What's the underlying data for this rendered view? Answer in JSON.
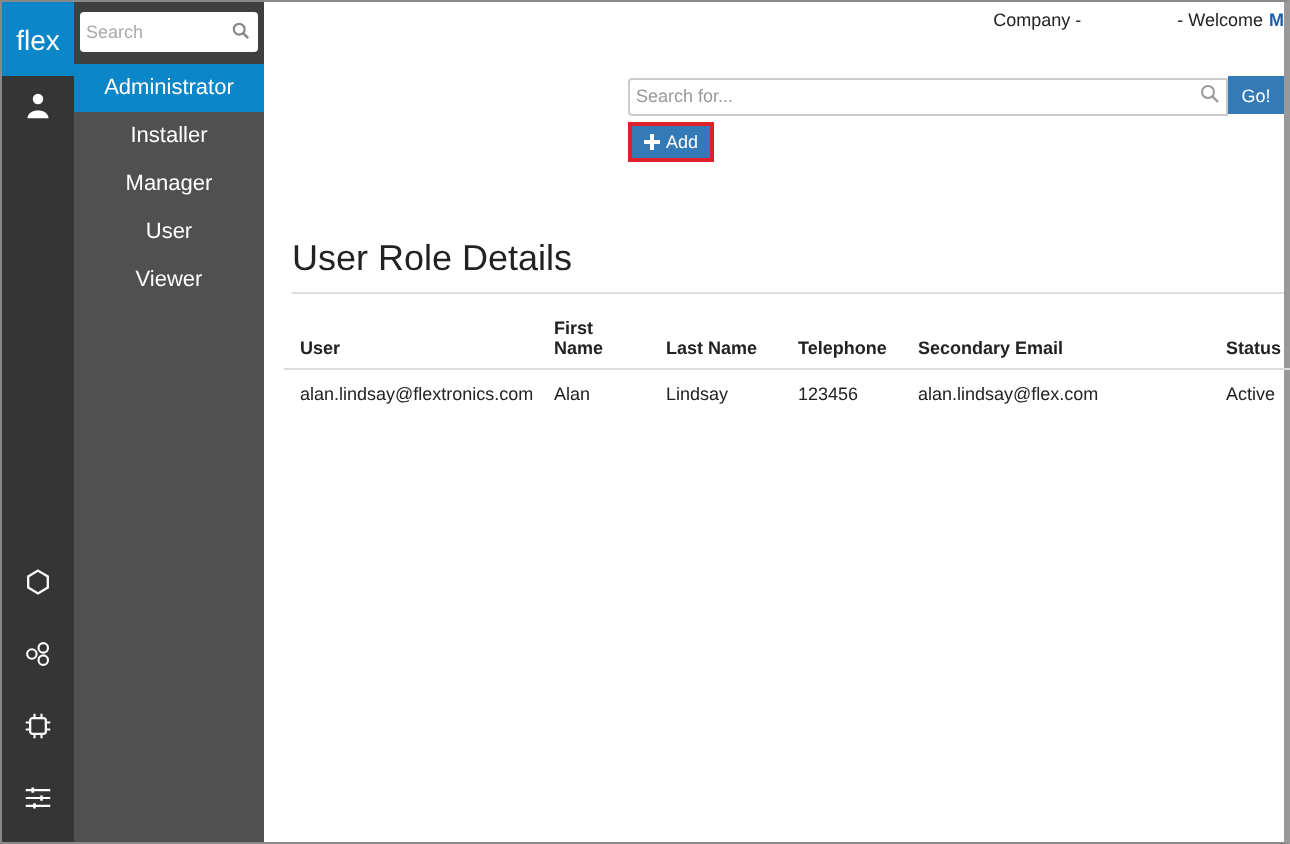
{
  "brand": "flex",
  "rail_icons": [
    {
      "kind": "user"
    },
    {
      "kind": "hexagon"
    },
    {
      "kind": "circles"
    },
    {
      "kind": "chip"
    },
    {
      "kind": "sliders"
    }
  ],
  "sidebar": {
    "search": {
      "placeholder": "Search"
    },
    "items": [
      {
        "label": "Administrator",
        "selected": true
      },
      {
        "label": "Installer",
        "selected": false
      },
      {
        "label": "Manager",
        "selected": false
      },
      {
        "label": "User",
        "selected": false
      },
      {
        "label": "Viewer",
        "selected": false
      }
    ]
  },
  "header": {
    "company": "Company -",
    "welcome": "- Welcome",
    "user": "M"
  },
  "search": {
    "placeholder": "Search for...",
    "button": "Go!"
  },
  "add_button": "Add",
  "title": "User Role Details",
  "table": {
    "columns": [
      "User",
      "First Name",
      "Last Name",
      "Telephone",
      "Secondary Email",
      "Status"
    ],
    "rows": [
      [
        "alan.lindsay@flextronics.com",
        "Alan",
        "Lindsay",
        "123456",
        "alan.lindsay@flex.com",
        "Active"
      ]
    ]
  }
}
